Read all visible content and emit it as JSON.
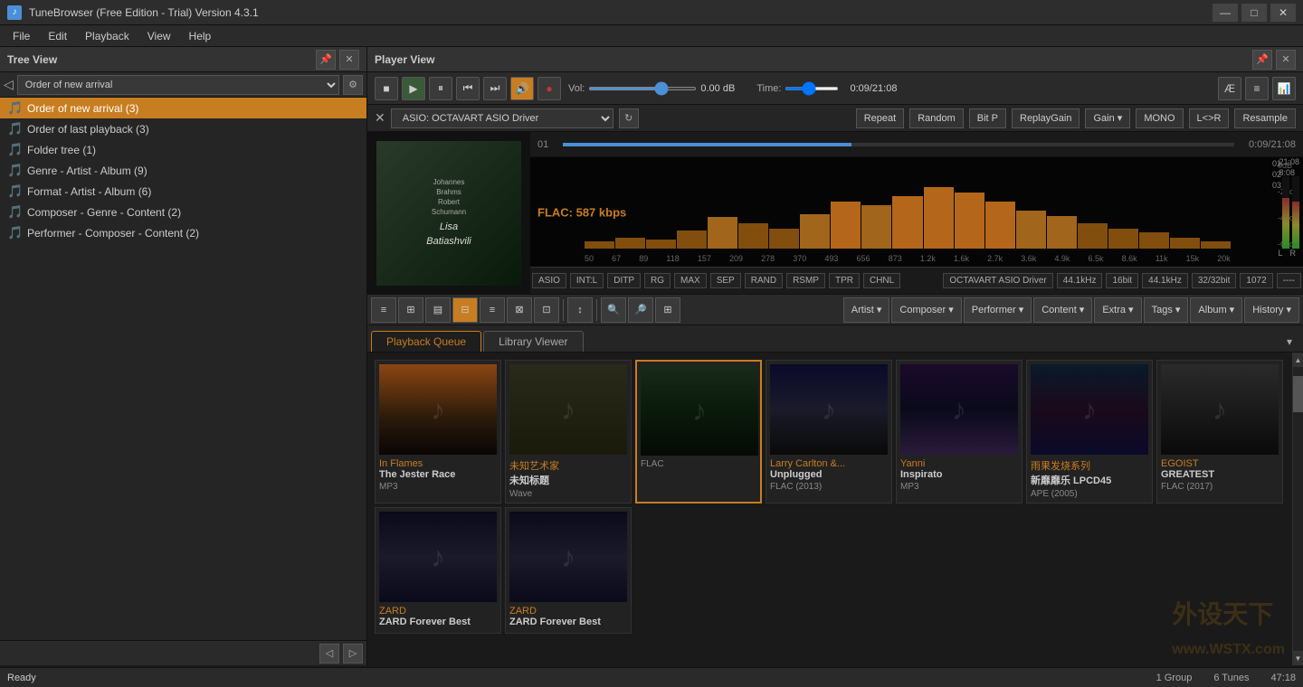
{
  "app": {
    "title": "TuneBrowser (Free Edition - Trial) Version 4.3.1",
    "icon": "♪"
  },
  "titlebar": {
    "minimize": "—",
    "maximize": "□",
    "close": "✕"
  },
  "menubar": {
    "items": [
      "File",
      "Edit",
      "Playback",
      "View",
      "Help"
    ]
  },
  "treeview": {
    "title": "Tree View",
    "dropdown_value": "Order of new arrival",
    "items": [
      {
        "label": "Order of new arrival (3)",
        "icon": "🎵",
        "selected": true,
        "level": 0
      },
      {
        "label": "Order of last playback (3)",
        "icon": "🎵",
        "selected": false,
        "level": 0
      },
      {
        "label": "Folder tree (1)",
        "icon": "🎵",
        "selected": false,
        "level": 0
      },
      {
        "label": "Genre - Artist - Album (9)",
        "icon": "🎵",
        "selected": false,
        "level": 0
      },
      {
        "label": "Format - Artist - Album (6)",
        "icon": "🎵",
        "selected": false,
        "level": 0
      },
      {
        "label": "Composer - Genre - Content (2)",
        "icon": "🎵",
        "selected": false,
        "level": 0
      },
      {
        "label": "Performer - Composer - Content (2)",
        "icon": "🎵",
        "selected": false,
        "level": 0
      }
    ]
  },
  "playerview": {
    "title": "Player View"
  },
  "transport": {
    "stop_label": "■",
    "play_label": "▶",
    "pause_label": "⏸",
    "prev_label": "⏮",
    "next_label": "⏭",
    "vol_label": "Vol:",
    "vol_value": "0.00 dB",
    "time_label": "Time:",
    "time_display": "0:09/21:08"
  },
  "device": {
    "name": "ASIO: OCTAVART ASIO Driver",
    "close_icon": "✕"
  },
  "dsp_buttons": [
    "Repeat",
    "Random",
    "Bit P",
    "ReplayGain",
    "Gain",
    "MONO",
    "L<>R",
    "Resample"
  ],
  "track": {
    "number": "01",
    "time": "0:09/21:08",
    "flac_info": "FLAC: 587 kbps",
    "progress_pct": 43
  },
  "freq_labels": [
    "50",
    "67",
    "89",
    "118",
    "157",
    "209",
    "278",
    "370",
    "493",
    "656",
    "873",
    "1.2k",
    "1.6k",
    "2.7k",
    "3.6k",
    "4.9k",
    "6.5k",
    "8.6k",
    "11k",
    "15k",
    "20k"
  ],
  "spectrum_bars": [
    15,
    25,
    18,
    30,
    45,
    35,
    28,
    40,
    55,
    50,
    60,
    70,
    65,
    55,
    45,
    40,
    30,
    25,
    20,
    15,
    10
  ],
  "status_boxes": [
    {
      "label": "OCTAVART ASIO Driver",
      "active": false
    },
    {
      "label": "44.1kHz",
      "active": false
    },
    {
      "label": "16bit",
      "active": false
    },
    {
      "label": "44.1kHz",
      "active": false
    },
    {
      "label": "32/32bit",
      "active": false
    },
    {
      "label": "1072",
      "active": false
    },
    {
      "label": "----",
      "active": false
    }
  ],
  "status_boxes2": [
    {
      "label": "ASIO"
    },
    {
      "label": "INT:L"
    },
    {
      "label": "DITP"
    },
    {
      "label": "RG"
    },
    {
      "label": "MAX"
    },
    {
      "label": "SEP"
    },
    {
      "label": "RAND"
    },
    {
      "label": "RSMP"
    },
    {
      "label": "TPR"
    },
    {
      "label": "CHNL"
    }
  ],
  "lib_toolbar": {
    "view_btns": [
      "≡",
      "⊞",
      "▤",
      "⊟",
      "≡",
      "⊠",
      "⊡"
    ],
    "sort_btn": "↕",
    "search_btn": "🔍",
    "zoom_btn": "🔎",
    "filter_btn": "⊞"
  },
  "dropdowns": [
    "Artist",
    "Composer",
    "Performer",
    "Content",
    "Extra",
    "Tags",
    "Album",
    "History"
  ],
  "tabs": {
    "items": [
      "Playback Queue",
      "Library Viewer"
    ],
    "active": 0
  },
  "albums": [
    {
      "artist": "In Flames",
      "title": "The Jester Race",
      "format": "MP3",
      "art_class": "art-in-flames",
      "selected": false
    },
    {
      "artist": "未知艺术家",
      "title": "未知标题",
      "format": "Wave",
      "art_class": "art-unknown",
      "selected": false
    },
    {
      "artist": "",
      "title": "",
      "format": "FLAC",
      "art_class": "art-lisa",
      "selected": true
    },
    {
      "artist": "Larry Carlton &...",
      "title": "Unplugged",
      "format": "FLAC (2013)",
      "art_class": "art-larry",
      "selected": false
    },
    {
      "artist": "Yanni",
      "title": "Inspirato",
      "format": "MP3",
      "art_class": "art-yanni",
      "selected": false
    },
    {
      "artist": "雨果发烧系列",
      "title": "新靡靡乐 LPCD45",
      "format": "APE (2005)",
      "art_class": "art-ume",
      "selected": false
    },
    {
      "artist": "EGOIST",
      "title": "GREATEST",
      "format": "FLAC (2017)",
      "art_class": "art-egoist",
      "selected": false
    },
    {
      "artist": "ZARD",
      "title": "ZARD Forever Best",
      "format": "",
      "art_class": "art-zard",
      "selected": false
    },
    {
      "artist": "ZARD",
      "title": "ZARD Forever Best",
      "format": "",
      "art_class": "art-zard",
      "selected": false
    }
  ],
  "statusbar": {
    "ready": "Ready",
    "group_count": "1 Group",
    "tune_count": "6 Tunes",
    "duration": "47:18"
  }
}
